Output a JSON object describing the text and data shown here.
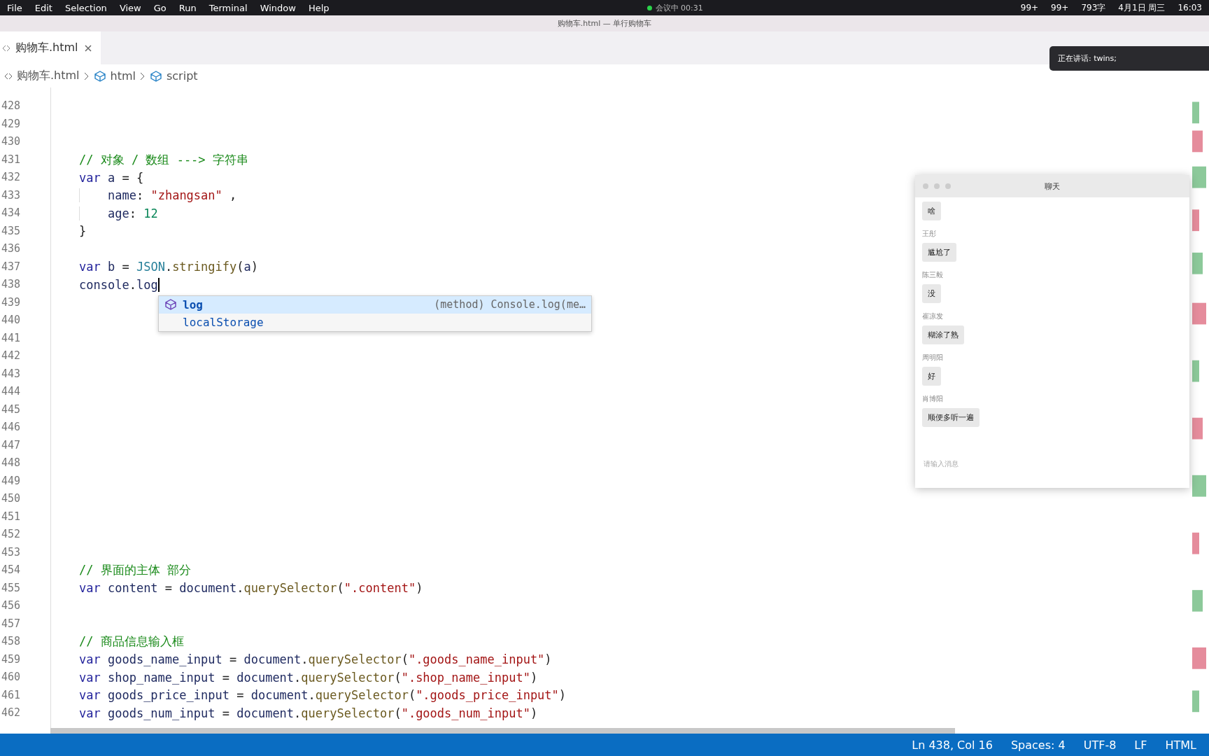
{
  "menu_bar": {
    "items": [
      "File",
      "Edit",
      "Selection",
      "View",
      "Go",
      "Run",
      "Terminal",
      "Window",
      "Help"
    ],
    "meeting": "会议中 00:31",
    "status": [
      "99+",
      "99+",
      "793字",
      "4月1日 周三",
      "16:03"
    ]
  },
  "window": {
    "title": "购物车.html — 单行购物车"
  },
  "tabs": [
    {
      "label": "购物车.html",
      "selected": true
    }
  ],
  "breadcrumb": [
    "购物车.html",
    "html",
    "script"
  ],
  "editor": {
    "lines": [
      {
        "number": "428"
      },
      {
        "number": "429"
      },
      {
        "number": "430"
      },
      {
        "number": "431",
        "indented": false,
        "cursor": false,
        "tokens": [
          {
            "kind": "comment",
            "text": "// 对象 / 数组 ---> 字符串"
          }
        ]
      },
      {
        "number": "432",
        "indented": false,
        "cursor": false,
        "tokens": [
          {
            "kind": "keyword",
            "text": "var"
          },
          {
            "kind": "ident",
            "text": " a"
          },
          {
            "kind": "plain",
            "text": " = {"
          }
        ]
      },
      {
        "number": "433",
        "indented": true,
        "cursor": false,
        "tokens": [
          {
            "kind": "ident",
            "text": "name"
          },
          {
            "kind": "plain",
            "text": ": "
          },
          {
            "kind": "string",
            "text": "\"zhangsan\""
          },
          {
            "kind": "plain",
            "text": " ,"
          }
        ]
      },
      {
        "number": "434",
        "indented": true,
        "cursor": false,
        "tokens": [
          {
            "kind": "ident",
            "text": "age"
          },
          {
            "kind": "plain",
            "text": ": "
          },
          {
            "kind": "number",
            "text": "12"
          }
        ]
      },
      {
        "number": "435",
        "indented": false,
        "cursor": false,
        "tokens": [
          {
            "kind": "plain",
            "text": "}"
          }
        ]
      },
      {
        "number": "436"
      },
      {
        "number": "437",
        "indented": false,
        "cursor": false,
        "tokens": [
          {
            "kind": "keyword",
            "text": "var"
          },
          {
            "kind": "ident",
            "text": " b"
          },
          {
            "kind": "plain",
            "text": " = "
          },
          {
            "kind": "type",
            "text": "JSON"
          },
          {
            "kind": "plain",
            "text": "."
          },
          {
            "kind": "func",
            "text": "stringify"
          },
          {
            "kind": "plain",
            "text": "("
          },
          {
            "kind": "ident",
            "text": "a"
          },
          {
            "kind": "plain",
            "text": ")"
          }
        ]
      },
      {
        "number": "438",
        "indented": false,
        "cursor": true,
        "tokens": [
          {
            "kind": "ident",
            "text": "console"
          },
          {
            "kind": "plain",
            "text": "."
          },
          {
            "kind": "ident",
            "text": "log"
          }
        ]
      },
      {
        "number": "439"
      },
      {
        "number": "440"
      },
      {
        "number": "441"
      },
      {
        "number": "442"
      },
      {
        "number": "443"
      },
      {
        "number": "444"
      },
      {
        "number": "445"
      },
      {
        "number": "446"
      },
      {
        "number": "447"
      },
      {
        "number": "448"
      },
      {
        "number": "449"
      },
      {
        "number": "450"
      },
      {
        "number": "451"
      },
      {
        "number": "452"
      },
      {
        "number": "453"
      },
      {
        "number": "454",
        "indented": false,
        "cursor": false,
        "tokens": [
          {
            "kind": "comment",
            "text": "// 界面的主体 部分"
          }
        ]
      },
      {
        "number": "455",
        "indented": false,
        "cursor": false,
        "tokens": [
          {
            "kind": "keyword",
            "text": "var"
          },
          {
            "kind": "ident",
            "text": " content"
          },
          {
            "kind": "plain",
            "text": " = "
          },
          {
            "kind": "ident",
            "text": "document"
          },
          {
            "kind": "plain",
            "text": "."
          },
          {
            "kind": "func",
            "text": "querySelector"
          },
          {
            "kind": "plain",
            "text": "("
          },
          {
            "kind": "string",
            "text": "\".content\""
          },
          {
            "kind": "plain",
            "text": ")"
          }
        ]
      },
      {
        "number": "456"
      },
      {
        "number": "457"
      },
      {
        "number": "458",
        "indented": false,
        "cursor": false,
        "tokens": [
          {
            "kind": "comment",
            "text": "// 商品信息输入框"
          }
        ]
      },
      {
        "number": "459",
        "indented": false,
        "cursor": false,
        "tokens": [
          {
            "kind": "keyword",
            "text": "var"
          },
          {
            "kind": "ident",
            "text": " goods_name_input"
          },
          {
            "kind": "plain",
            "text": " = "
          },
          {
            "kind": "ident",
            "text": "document"
          },
          {
            "kind": "plain",
            "text": "."
          },
          {
            "kind": "func",
            "text": "querySelector"
          },
          {
            "kind": "plain",
            "text": "("
          },
          {
            "kind": "string",
            "text": "\".goods_name_input\""
          },
          {
            "kind": "plain",
            "text": ")"
          }
        ]
      },
      {
        "number": "460",
        "indented": false,
        "cursor": false,
        "tokens": [
          {
            "kind": "keyword",
            "text": "var"
          },
          {
            "kind": "ident",
            "text": " shop_name_input"
          },
          {
            "kind": "plain",
            "text": " = "
          },
          {
            "kind": "ident",
            "text": "document"
          },
          {
            "kind": "plain",
            "text": "."
          },
          {
            "kind": "func",
            "text": "querySelector"
          },
          {
            "kind": "plain",
            "text": "("
          },
          {
            "kind": "string",
            "text": "\".shop_name_input\""
          },
          {
            "kind": "plain",
            "text": ")"
          }
        ]
      },
      {
        "number": "461",
        "indented": false,
        "cursor": false,
        "tokens": [
          {
            "kind": "keyword",
            "text": "var"
          },
          {
            "kind": "ident",
            "text": " goods_price_input"
          },
          {
            "kind": "plain",
            "text": " = "
          },
          {
            "kind": "ident",
            "text": "document"
          },
          {
            "kind": "plain",
            "text": "."
          },
          {
            "kind": "func",
            "text": "querySelector"
          },
          {
            "kind": "plain",
            "text": "("
          },
          {
            "kind": "string",
            "text": "\".goods_price_input\""
          },
          {
            "kind": "plain",
            "text": ")"
          }
        ]
      },
      {
        "number": "462",
        "indented": false,
        "cursor": false,
        "tokens": [
          {
            "kind": "keyword",
            "text": "var"
          },
          {
            "kind": "ident",
            "text": " goods_num_input"
          },
          {
            "kind": "plain",
            "text": " = "
          },
          {
            "kind": "ident",
            "text": "document"
          },
          {
            "kind": "plain",
            "text": "."
          },
          {
            "kind": "func",
            "text": "querySelector"
          },
          {
            "kind": "plain",
            "text": "("
          },
          {
            "kind": "string",
            "text": "\".goods_num_input\""
          },
          {
            "kind": "plain",
            "text": ")"
          }
        ]
      }
    ]
  },
  "suggestions": [
    {
      "label": "log",
      "detail": "(method) Console.log(me…",
      "selected": true
    },
    {
      "label": "localStorage",
      "selected": false
    }
  ],
  "notification": {
    "text": "正在讲话: twins;"
  },
  "chat": {
    "title": "聊天",
    "messages": [
      {
        "text": "啥"
      },
      {
        "sender": "王彤",
        "text": "尴尬了"
      },
      {
        "sender": "陈三毅",
        "text": "没"
      },
      {
        "sender": "崔凉发",
        "text": "糊涂了熟"
      },
      {
        "sender": "周明阳",
        "text": "好"
      },
      {
        "sender": "肖博阳",
        "text": "顺便多听一遍"
      }
    ],
    "input": {
      "placeholder": "请输入消息"
    }
  },
  "status_bar": [
    "Ln 438, Col 16",
    "Spaces: 4",
    "UTF-8",
    "LF",
    "HTML"
  ]
}
